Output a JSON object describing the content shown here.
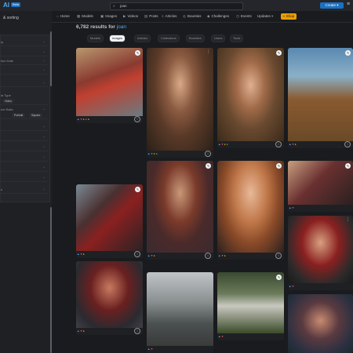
{
  "app": {
    "logo": "AI",
    "logo_badge": "Beta",
    "search_query": "joan",
    "create_label": "Create"
  },
  "nav": {
    "items": [
      {
        "label": "Home",
        "icon": "⌂"
      },
      {
        "label": "Models",
        "icon": "▦"
      },
      {
        "label": "Images",
        "icon": "▣"
      },
      {
        "label": "Videos",
        "icon": "▶"
      },
      {
        "label": "Posts",
        "icon": "▤"
      },
      {
        "label": "Articles",
        "icon": "≡"
      },
      {
        "label": "Bounties",
        "icon": "◎"
      },
      {
        "label": "Challenges",
        "icon": "◆"
      },
      {
        "label": "Events",
        "icon": "◷"
      },
      {
        "label": "Updates",
        "icon": "▾"
      },
      {
        "label": "Shop",
        "icon": "▪"
      }
    ]
  },
  "sidebar": {
    "heading": "& sorting",
    "rows": [
      {
        "label": "ty"
      },
      {
        "label": "tion Date"
      },
      {
        "label": ""
      },
      {
        "label": ""
      },
      {
        "label": "ia Type"
      },
      {
        "label": "ect Ratio"
      },
      {
        "label": ""
      },
      {
        "label": ""
      },
      {
        "label": ""
      },
      {
        "label": ""
      },
      {
        "label": ""
      },
      {
        "label": ""
      },
      {
        "label": "s"
      }
    ],
    "chips": {
      "video": "Video",
      "portrait": "Portrait",
      "square": "Square"
    }
  },
  "results": {
    "count_text": "6,782 results for",
    "query": "joan"
  },
  "filters": [
    {
      "label": "Models",
      "active": false
    },
    {
      "label": "Images",
      "active": true
    },
    {
      "label": "Articles",
      "active": false
    },
    {
      "label": "Collections",
      "active": false
    },
    {
      "label": "Bounties",
      "active": false
    },
    {
      "label": "Users",
      "active": false
    },
    {
      "label": "Tools",
      "active": false
    }
  ]
}
